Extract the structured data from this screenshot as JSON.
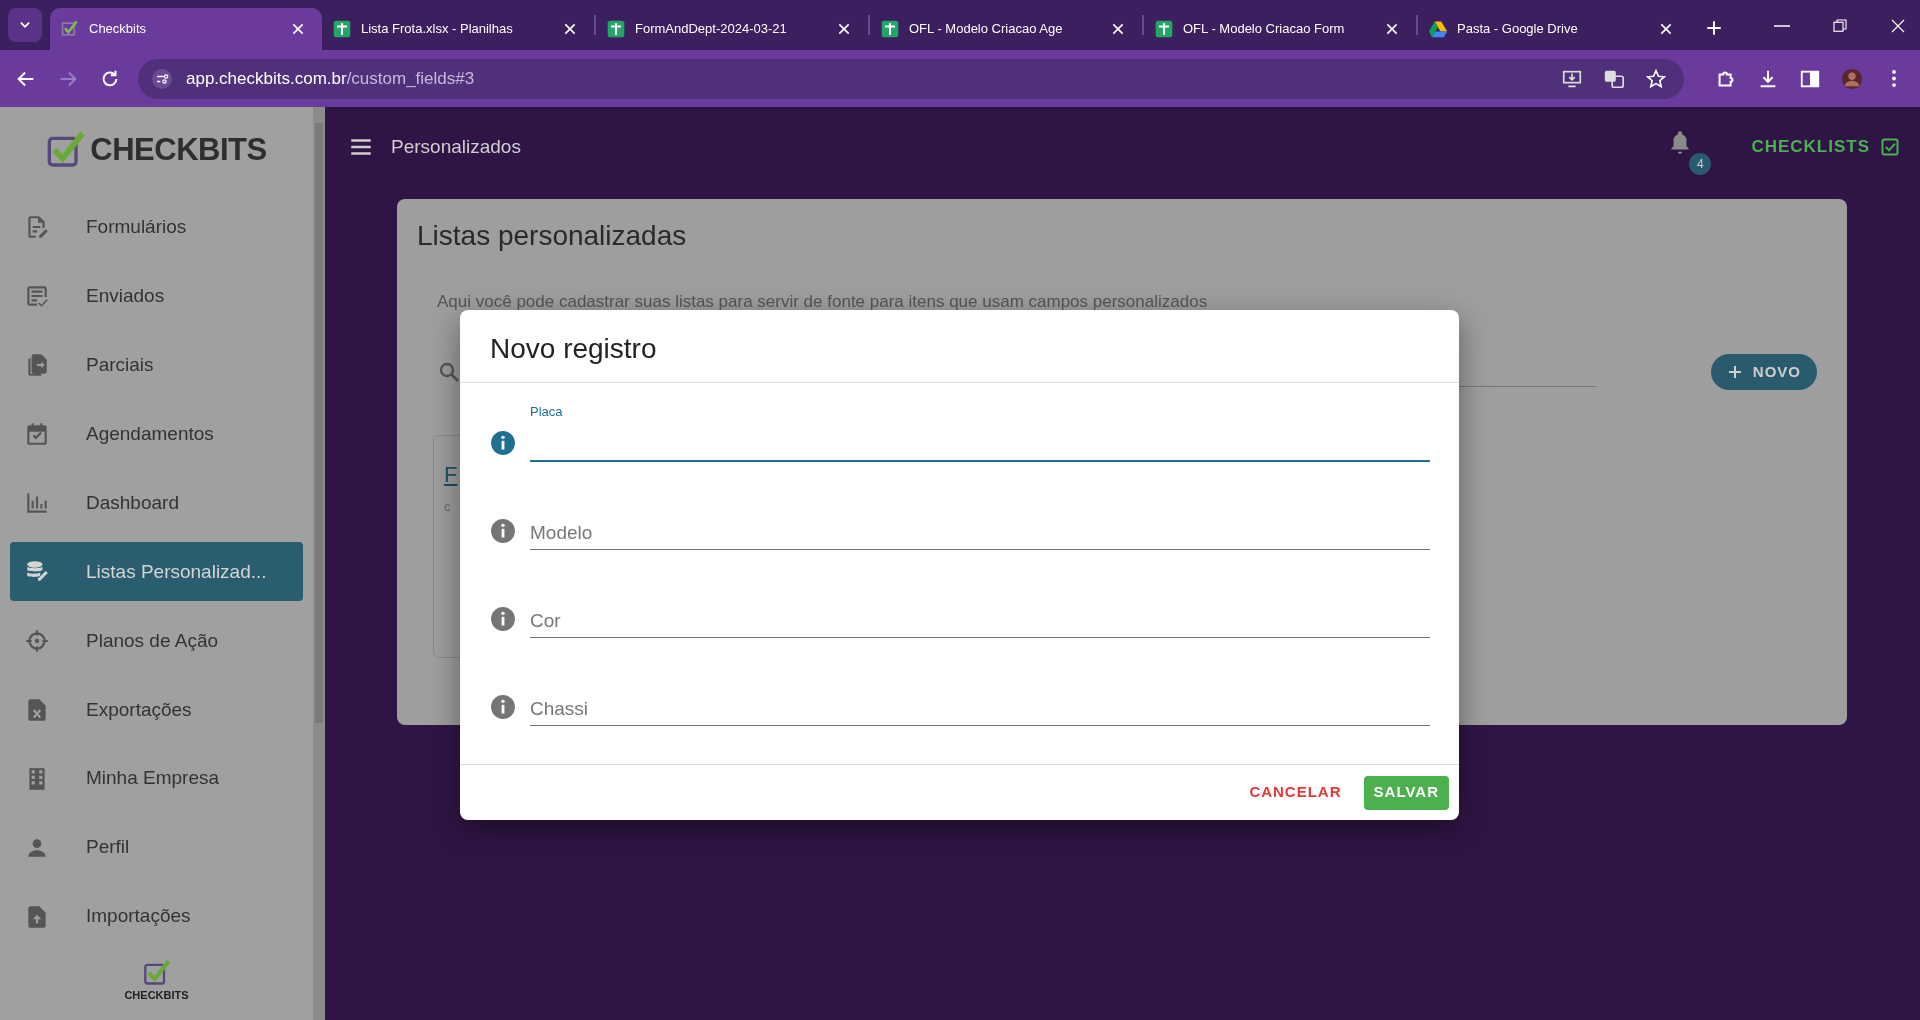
{
  "browser": {
    "tabs": [
      {
        "title": "Checkbits",
        "kind": "checkbits",
        "selected": true
      },
      {
        "title": "Lista Frota.xlsx - Planilhas",
        "kind": "sheets",
        "selected": false
      },
      {
        "title": "FormAndDept-2024-03-21",
        "kind": "sheets",
        "selected": false
      },
      {
        "title": "OFL - Modelo Criacao Age",
        "kind": "sheets",
        "selected": false
      },
      {
        "title": "OFL - Modelo Criacao Form",
        "kind": "sheets",
        "selected": false
      },
      {
        "title": "Pasta - Google Drive",
        "kind": "drive",
        "selected": false
      }
    ],
    "url_host": "app.checkbits.com.br",
    "url_path": "/custom_fields#3"
  },
  "sidebar": {
    "logo_text": "CHECKBITS",
    "items": [
      {
        "label": "Formulários",
        "selected": false
      },
      {
        "label": "Enviados",
        "selected": false
      },
      {
        "label": "Parciais",
        "selected": false
      },
      {
        "label": "Agendamentos",
        "selected": false
      },
      {
        "label": "Dashboard",
        "selected": false
      },
      {
        "label": "Listas Personalizad...",
        "selected": true
      },
      {
        "label": "Planos de Ação",
        "selected": false
      },
      {
        "label": "Exportações",
        "selected": false
      },
      {
        "label": "Minha Empresa",
        "selected": false
      },
      {
        "label": "Perfil",
        "selected": false
      },
      {
        "label": "Importações",
        "selected": false
      }
    ],
    "footer_logo_text": "CHECKBITS"
  },
  "header": {
    "title": "Personalizados",
    "notification_count": "4",
    "brand_link": "CHECKLISTS"
  },
  "page": {
    "title": "Listas personalizadas",
    "description": "Aqui você pode cadastrar suas listas para servir de fonte para itens que usam campos personalizados",
    "new_button": "NOVO",
    "list_card": {
      "title": "F",
      "subtitle": "c"
    }
  },
  "dialog": {
    "title": "Novo registro",
    "fields": [
      {
        "label": "Placa",
        "focused": true
      },
      {
        "placeholder": "Modelo",
        "focused": false
      },
      {
        "placeholder": "Cor",
        "focused": false
      },
      {
        "placeholder": "Chassi",
        "focused": false
      }
    ],
    "buttons": [
      {
        "label": "CANCELAR",
        "kind": "text"
      },
      {
        "label": "SALVAR",
        "kind": "primary"
      }
    ]
  }
}
